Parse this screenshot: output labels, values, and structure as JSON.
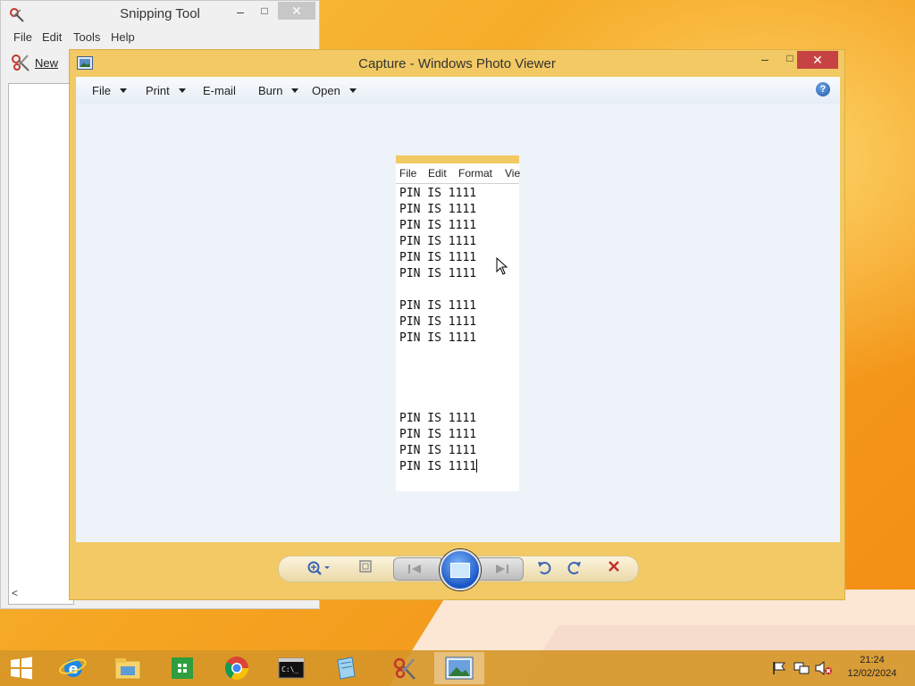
{
  "snipping_tool": {
    "title": "Snipping Tool",
    "menu": [
      "File",
      "Edit",
      "Tools",
      "Help"
    ],
    "new_label": "New",
    "minimize": "–",
    "maximize": "□",
    "close": "✕",
    "scroll_left": "<"
  },
  "photo_viewer": {
    "title": "Capture - Windows Photo Viewer",
    "minimize": "–",
    "maximize": "□",
    "close": "✕",
    "menu": {
      "file": "File",
      "print": "Print",
      "email": "E-mail",
      "burn": "Burn",
      "open": "Open"
    },
    "help": "?"
  },
  "capture": {
    "menu": [
      "File",
      "Edit",
      "Format",
      "Vie"
    ],
    "lines": [
      "PIN IS 1111",
      "PIN IS 1111",
      "PIN IS 1111",
      "PIN IS 1111",
      "PIN IS 1111",
      "PIN IS 1111",
      "",
      "PIN IS 1111",
      "PIN IS 1111",
      "PIN IS 1111",
      "",
      "",
      "",
      "",
      "PIN IS 1111",
      "PIN IS 1111",
      "PIN IS 1111",
      "PIN IS 1111"
    ]
  },
  "taskbar": {
    "items": [
      "internet-explorer",
      "file-explorer",
      "store",
      "chrome",
      "command-prompt",
      "notepad",
      "snipping-tool",
      "photo-viewer"
    ],
    "active_index": 7,
    "clock_time": "21:24",
    "clock_date": "12/02/2024"
  },
  "colors": {
    "accent": "#f2c964",
    "close_red": "#c74343",
    "taskbar": "#d69628"
  }
}
